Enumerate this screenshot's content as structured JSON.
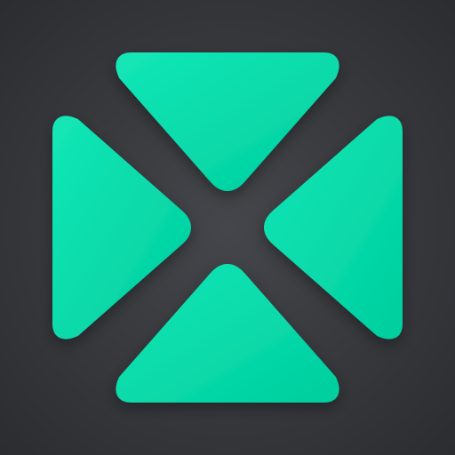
{
  "icon": {
    "name": "four-triangles-app-icon",
    "colors": {
      "background_outer": "#2b2c30",
      "background_center": "#45464b",
      "accent": "#06dcad",
      "accent_light": "#13e6b6",
      "accent_dark": "#00cf9f"
    }
  }
}
